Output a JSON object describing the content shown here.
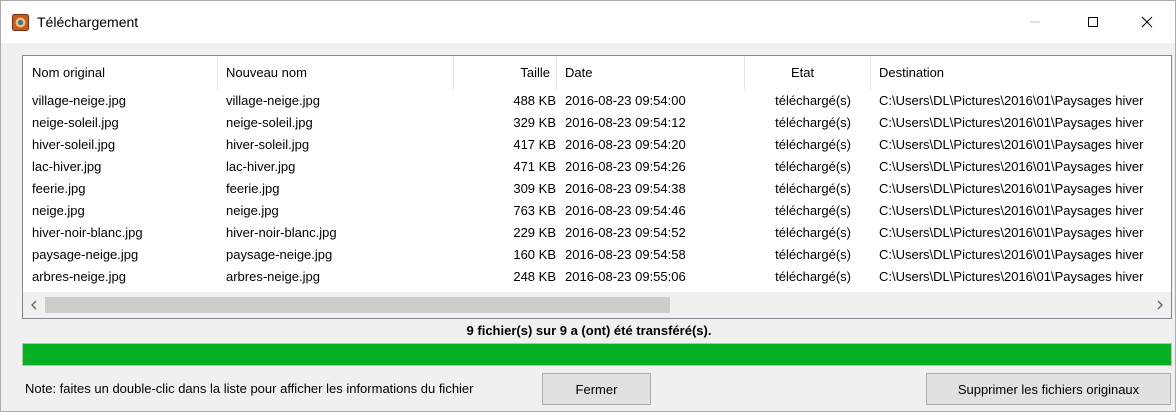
{
  "window": {
    "title": "Téléchargement",
    "accent": "#06b025"
  },
  "titlebar_buttons": {
    "minimize": "—",
    "maximize": "☐",
    "close": "✕"
  },
  "list": {
    "columns": {
      "original": "Nom original",
      "new": "Nouveau nom",
      "size": "Taille",
      "date": "Date",
      "state": "Etat",
      "destination": "Destination"
    },
    "rows": [
      {
        "original": "village-neige.jpg",
        "new": "village-neige.jpg",
        "size": "488 KB",
        "date": "2016-08-23 09:54:00",
        "state": "téléchargé(s)",
        "destination": "C:\\Users\\DL\\Pictures\\2016\\01\\Paysages hiver"
      },
      {
        "original": "neige-soleil.jpg",
        "new": "neige-soleil.jpg",
        "size": "329 KB",
        "date": "2016-08-23 09:54:12",
        "state": "téléchargé(s)",
        "destination": "C:\\Users\\DL\\Pictures\\2016\\01\\Paysages hiver"
      },
      {
        "original": "hiver-soleil.jpg",
        "new": "hiver-soleil.jpg",
        "size": "417 KB",
        "date": "2016-08-23 09:54:20",
        "state": "téléchargé(s)",
        "destination": "C:\\Users\\DL\\Pictures\\2016\\01\\Paysages hiver"
      },
      {
        "original": "lac-hiver.jpg",
        "new": "lac-hiver.jpg",
        "size": "471 KB",
        "date": "2016-08-23 09:54:26",
        "state": "téléchargé(s)",
        "destination": "C:\\Users\\DL\\Pictures\\2016\\01\\Paysages hiver"
      },
      {
        "original": "feerie.jpg",
        "new": "feerie.jpg",
        "size": "309 KB",
        "date": "2016-08-23 09:54:38",
        "state": "téléchargé(s)",
        "destination": "C:\\Users\\DL\\Pictures\\2016\\01\\Paysages hiver"
      },
      {
        "original": "neige.jpg",
        "new": "neige.jpg",
        "size": "763 KB",
        "date": "2016-08-23 09:54:46",
        "state": "téléchargé(s)",
        "destination": "C:\\Users\\DL\\Pictures\\2016\\01\\Paysages hiver"
      },
      {
        "original": "hiver-noir-blanc.jpg",
        "new": "hiver-noir-blanc.jpg",
        "size": "229 KB",
        "date": "2016-08-23 09:54:52",
        "state": "téléchargé(s)",
        "destination": "C:\\Users\\DL\\Pictures\\2016\\01\\Paysages hiver"
      },
      {
        "original": "paysage-neige.jpg",
        "new": "paysage-neige.jpg",
        "size": "160 KB",
        "date": "2016-08-23 09:54:58",
        "state": "téléchargé(s)",
        "destination": "C:\\Users\\DL\\Pictures\\2016\\01\\Paysages hiver"
      },
      {
        "original": "arbres-neige.jpg",
        "new": "arbres-neige.jpg",
        "size": "248 KB",
        "date": "2016-08-23 09:55:06",
        "state": "téléchargé(s)",
        "destination": "C:\\Users\\DL\\Pictures\\2016\\01\\Paysages hiver"
      }
    ],
    "scroll_left_icon": "chevron-left-icon",
    "scroll_right_icon": "chevron-right-icon"
  },
  "status": {
    "text": "9 fichier(s) sur 9 a (ont) été transféré(s).",
    "progress_percent": 100
  },
  "footer": {
    "note": "Note: faites un double-clic dans la liste pour afficher les informations du fichier",
    "close_label": "Fermer",
    "delete_label": "Supprimer les fichiers originaux"
  }
}
